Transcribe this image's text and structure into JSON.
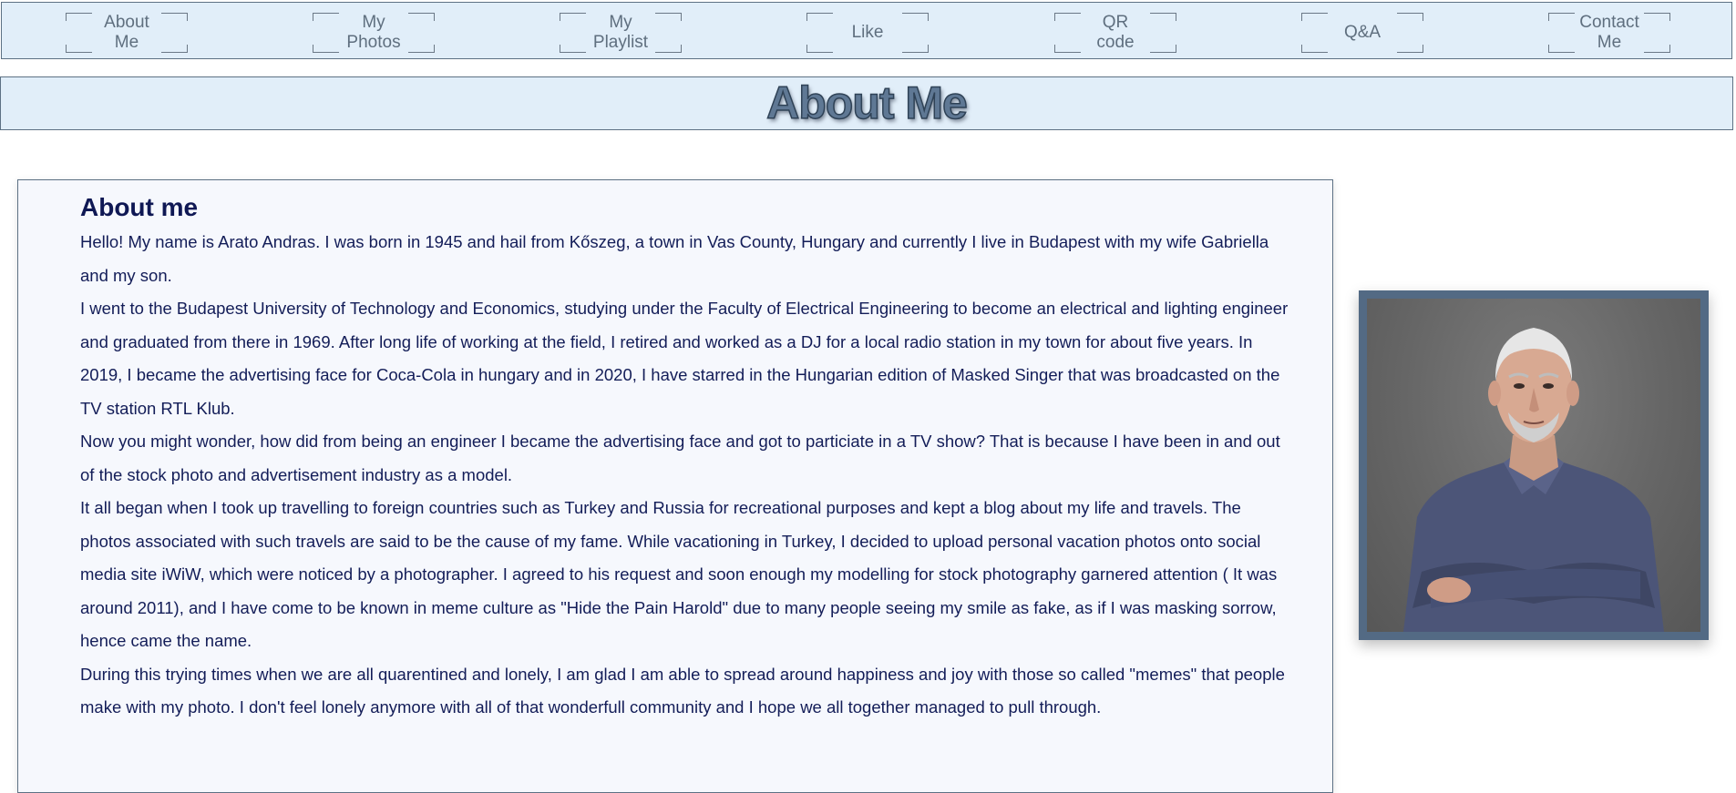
{
  "nav": {
    "items": [
      {
        "label": "About\nMe"
      },
      {
        "label": "My\nPhotos"
      },
      {
        "label": "My\nPlaylist"
      },
      {
        "label": "Like"
      },
      {
        "label": "QR\ncode"
      },
      {
        "label": "Q&A"
      },
      {
        "label": "Contact\nMe"
      }
    ]
  },
  "header": {
    "title": "About Me"
  },
  "main": {
    "heading": "About me",
    "paragraphs": [
      "Hello! My name is Arato Andras. I was born in 1945 and hail from Kőszeg, a town in Vas County, Hungary and currently I live in Budapest with my wife Gabriella and my son.",
      "I went to the Budapest University of Technology and Economics, studying under the Faculty of Electrical Engineering to become an electrical and lighting engineer and graduated from there in 1969. After long life of working at the field, I retired and worked as a DJ for a local radio station in my town for about five years. In 2019, I became the advertising face for Coca-Cola in hungary and in 2020, I have starred in the Hungarian edition of Masked Singer that was broadcasted on the TV station RTL Klub.",
      "Now you might wonder, how did from being an engineer I became the advertising face and got to particiate in a TV show? That is because I have been in and out of the stock photo and advertisement industry as a model.",
      "It all began when I took up travelling to foreign countries such as Turkey and Russia for recreational purposes and kept a blog about my life and travels. The photos associated with such travels are said to be the cause of my fame. While vacationing in Turkey, I decided to upload personal vacation photos onto social media site iWiW, which were noticed by a photographer. I agreed to his request and soon enough my modelling for stock photography garnered attention ( It was around 2011), and I have come to be known in meme culture as \"Hide the Pain Harold\" due to many people seeing my smile as fake, as if I was masking sorrow, hence came the name.",
      "During this trying times when we are all quarentined and lonely, I am glad I am able to spread around happiness and joy with those so called \"memes\" that people make with my photo. I don't feel lonely anymore with all of that wonderfull community and I hope we all together managed to pull through."
    ]
  },
  "colors": {
    "nav_bg": "#e1eef9",
    "border": "#5d7184",
    "text": "#131d58",
    "frame": "#536a84"
  }
}
